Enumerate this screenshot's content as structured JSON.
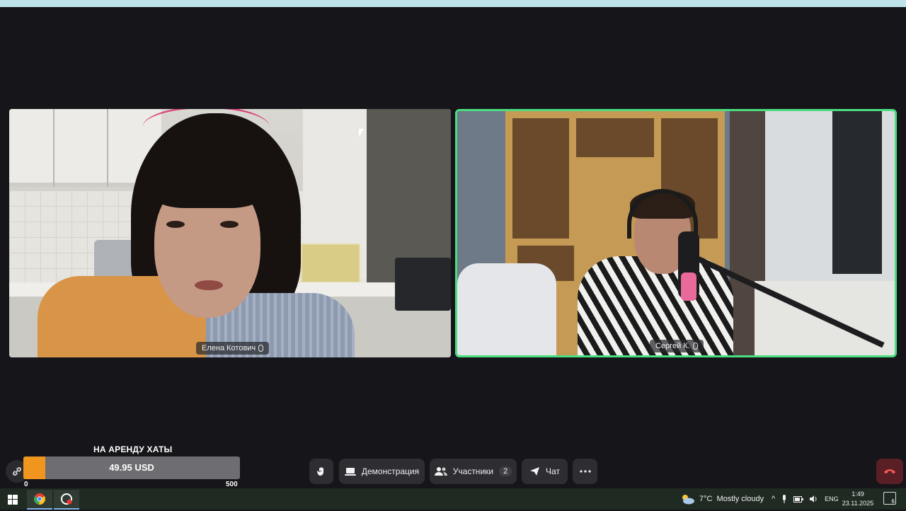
{
  "participants": [
    {
      "name": "Елена Котович",
      "mic": "mic-icon",
      "speaking": false
    },
    {
      "name": "Сергей К.",
      "mic": "mic-icon",
      "speaking": true
    }
  ],
  "donation": {
    "title": "НА АРЕНДУ ХАТЫ",
    "amount": "49.95 USD",
    "progress_fraction": 0.0999,
    "min_label": "0",
    "max_label": "500",
    "fill_color": "#f0961f"
  },
  "toolbar": {
    "raise_hand_icon": "hand-icon",
    "demo_label": "Демонстрация",
    "participants_label": "Участники",
    "participants_count": "2",
    "chat_label": "Чат",
    "more_icon": "more-icon",
    "end_call_icon": "phone-hangup-icon"
  },
  "colors": {
    "active_speaker_border": "#4ade80",
    "background": "#15151a",
    "end_call": "#5a1f24"
  },
  "taskbar": {
    "weather_temp": "7°C",
    "weather_text": "Mostly cloudy",
    "lang": "ENG",
    "time": "1:49",
    "date": "23.11.2025",
    "notifications": "6"
  }
}
